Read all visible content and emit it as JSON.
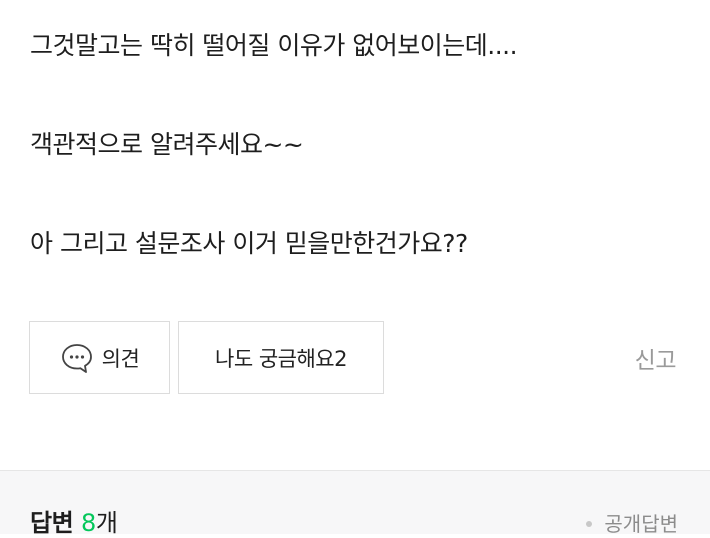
{
  "post": {
    "lines": [
      "그것말고는 딱히 떨어질 이유가 없어보이는데....",
      "객관적으로 알려주세요~~",
      "아 그리고 설문조사 이거 믿을만한건가요??"
    ]
  },
  "actions": {
    "opinion_label": "의견",
    "opinion_icon": "speech-bubble-icon",
    "curious_label": "나도 궁금해요2",
    "report_label": "신고"
  },
  "answers": {
    "title": "답변",
    "count": "8",
    "count_suffix": "개",
    "filter_label": "공개답변"
  },
  "colors": {
    "accent": "#03c75a",
    "muted_text": "#9a9a9a",
    "border": "#dcdcdc",
    "section_bg": "#f7f7f8"
  }
}
